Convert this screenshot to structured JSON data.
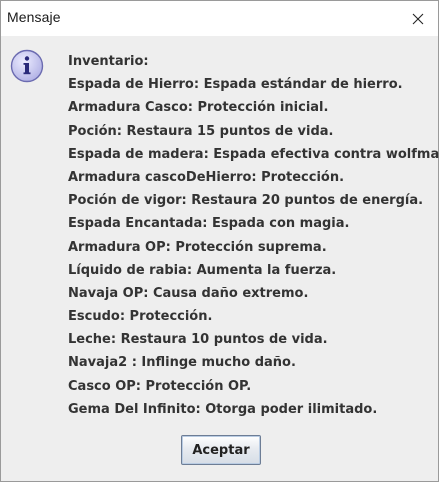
{
  "window": {
    "title": "Mensaje"
  },
  "icons": {
    "info": "info-icon",
    "close": "close-icon"
  },
  "message": {
    "lines": [
      "Inventario:",
      "Espada de Hierro: Espada estándar de hierro.",
      "Armadura Casco: Protección inicial.",
      "Poción: Restaura 15 puntos de vida.",
      "Espada de madera: Espada efectiva contra wolfman.",
      "Armadura cascoDeHierro: Protección.",
      "Poción de vigor: Restaura 20 puntos de energía.",
      "Espada Encantada: Espada con magia.",
      "Armadura OP: Protección suprema.",
      "Líquido de rabia: Aumenta la fuerza.",
      "Navaja OP: Causa daño extremo.",
      "Escudo: Protección.",
      "Leche: Restaura 10 puntos de vida.",
      "Navaja2 : Inflinge mucho daño.",
      "Casco OP: Protección OP.",
      "Gema Del Infinito: Otorga poder ilimitado."
    ]
  },
  "buttons": {
    "ok_label": "Aceptar"
  },
  "colors": {
    "dialog_background": "#eeeeee",
    "text": "#333333",
    "info_icon_fill": "#c8c8ee",
    "info_icon_stroke": "#6b6bb0"
  }
}
